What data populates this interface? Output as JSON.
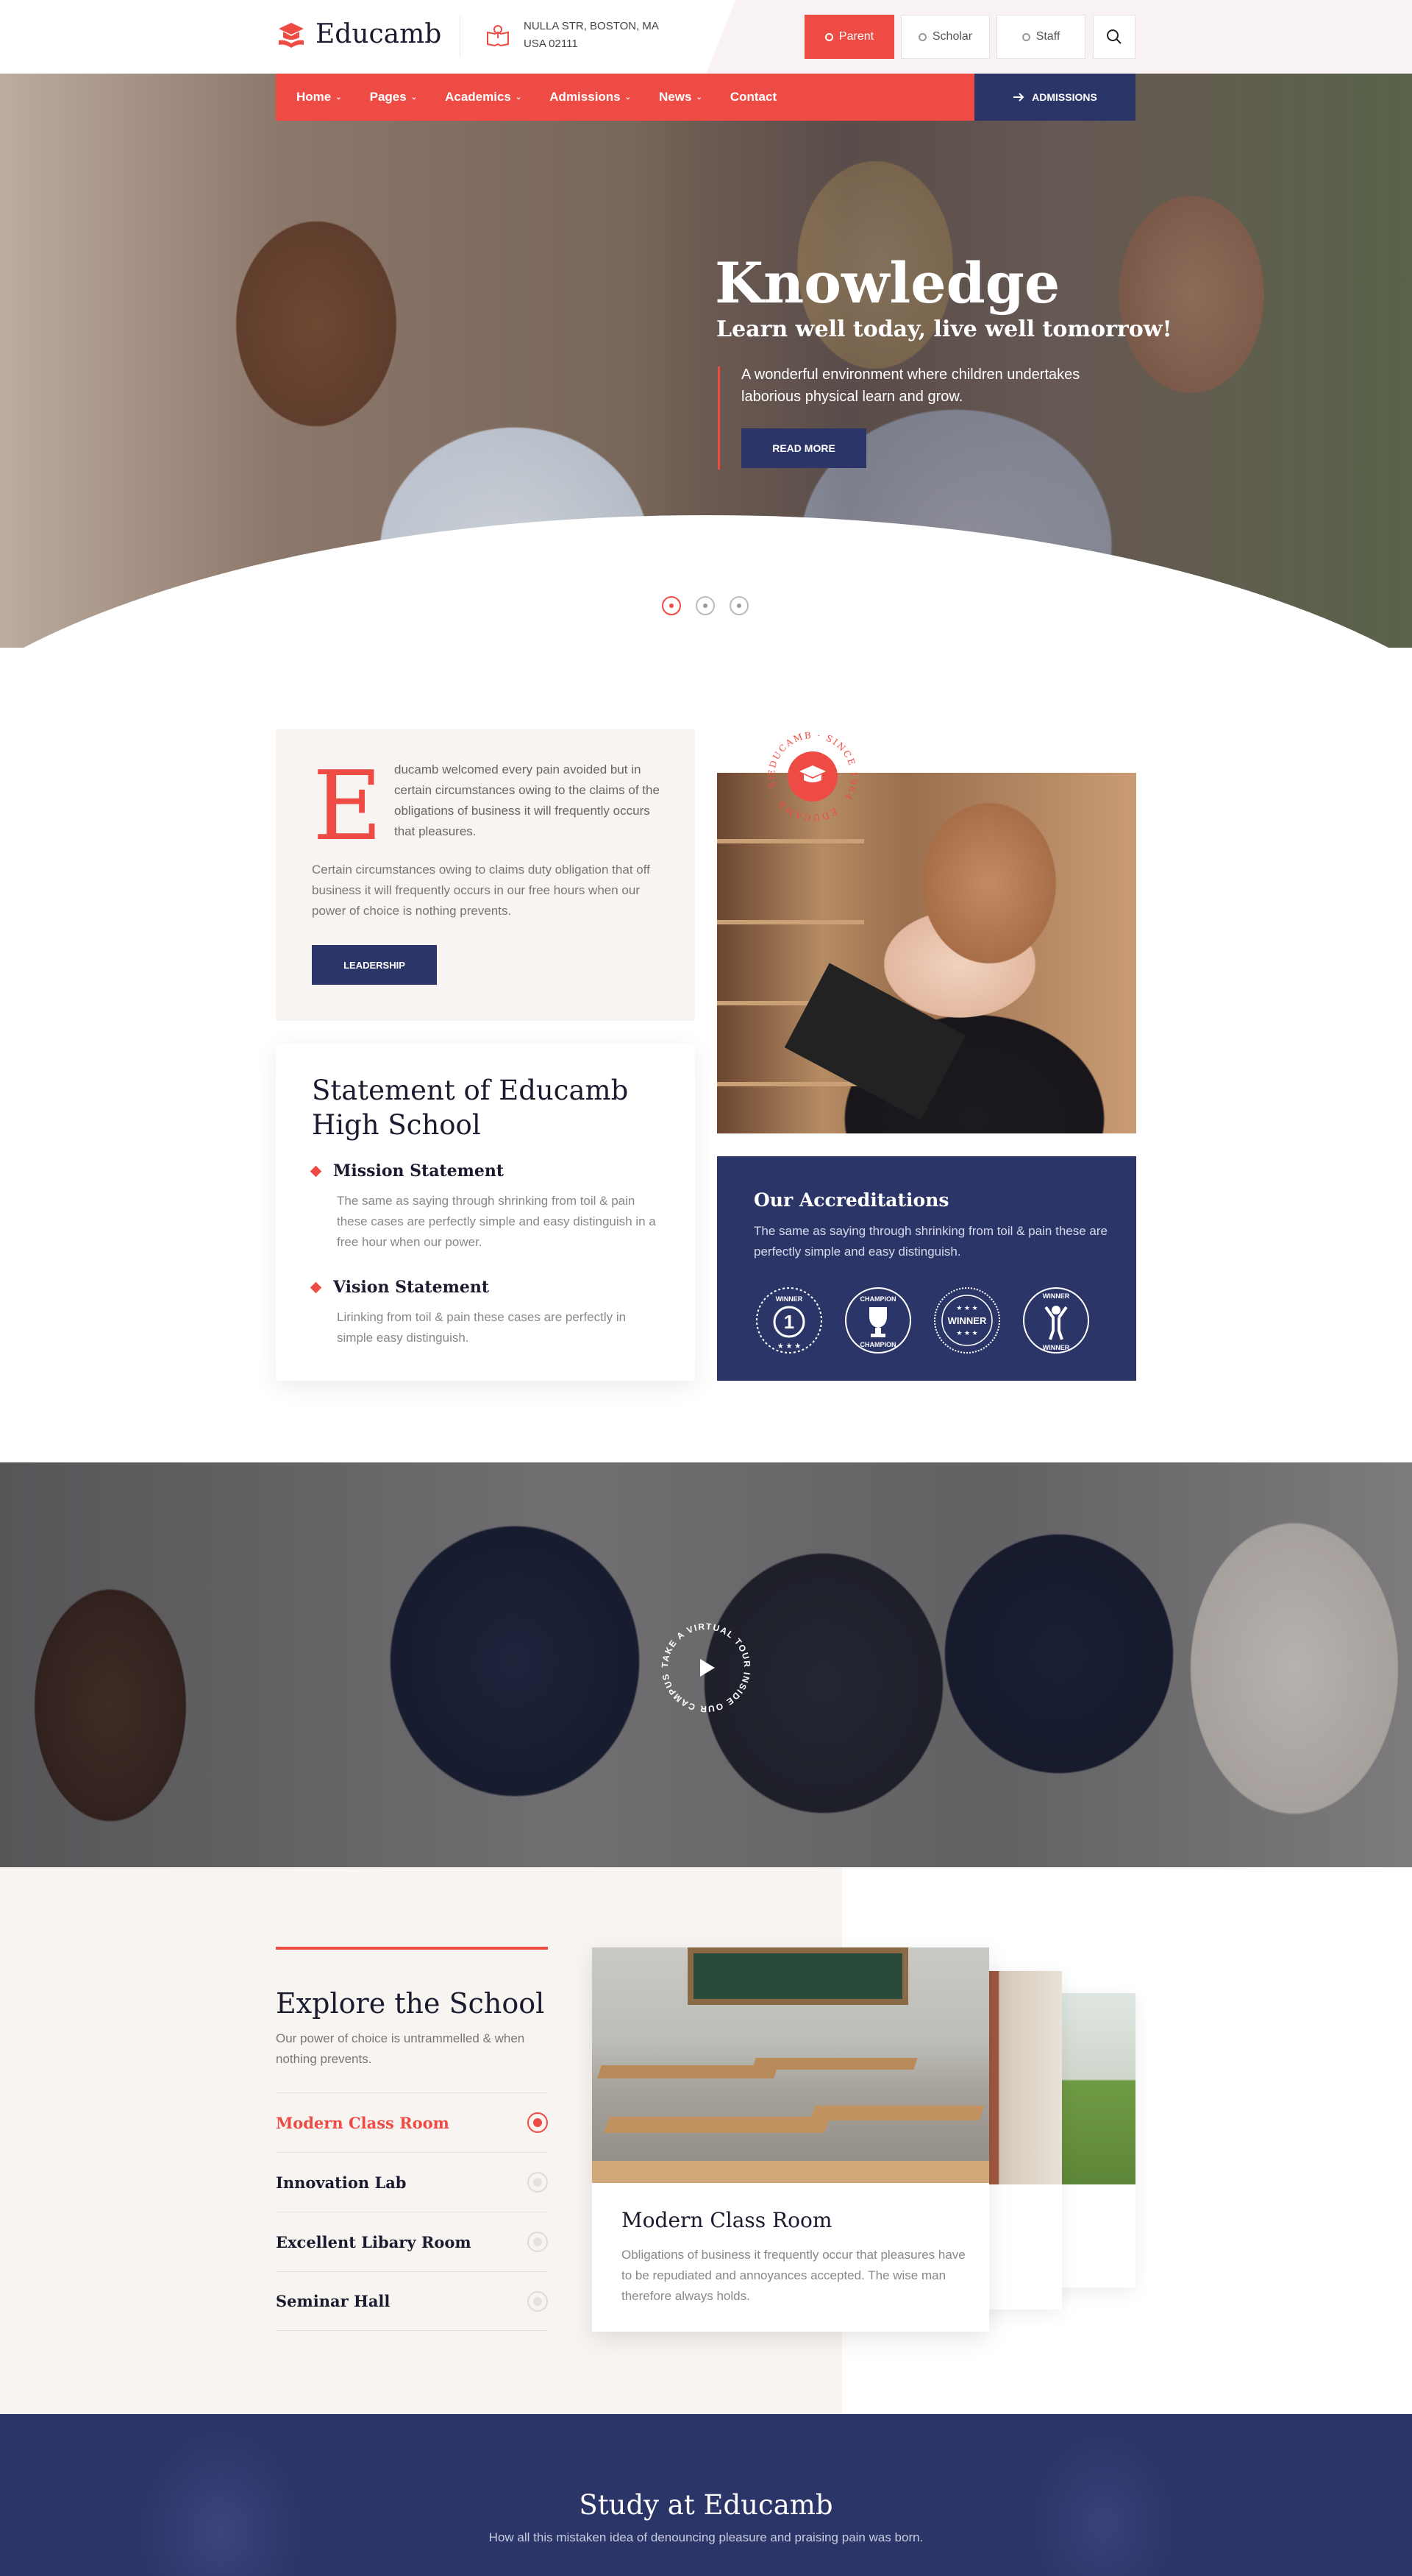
{
  "header": {
    "logo_text": "Educamb",
    "address_line1": "NULLA STR, BOSTON, MA",
    "address_line2": "USA 02111",
    "roles": [
      {
        "label": "Parent",
        "active": true
      },
      {
        "label": "Scholar",
        "active": false
      },
      {
        "label": "Staff",
        "active": false
      }
    ]
  },
  "nav": {
    "items": [
      {
        "label": "Home",
        "dropdown": true
      },
      {
        "label": "Pages",
        "dropdown": true
      },
      {
        "label": "Academics",
        "dropdown": true
      },
      {
        "label": "Admissions",
        "dropdown": true
      },
      {
        "label": "News",
        "dropdown": true
      },
      {
        "label": "Contact",
        "dropdown": false
      }
    ],
    "cta_label": "ADMISSIONS"
  },
  "hero": {
    "title": "Knowledge",
    "subtitle": "Learn well today, live well tomorrow!",
    "description": "A wonderful environment where children undertakes laborious physical learn and grow.",
    "button_label": "READ MORE",
    "slide_count": 3,
    "active_slide": 1
  },
  "about": {
    "dropcap": "E",
    "paragraph1": "ducamb welcomed every pain avoided but in certain circumstances owing to the claims of the obligations of business it will frequently occurs that pleasures.",
    "paragraph2": "Certain circumstances owing to claims duty obligation that off business it will frequently occurs in our free hours when our power of choice is nothing prevents.",
    "button_label": "LEADERSHIP",
    "badge_text": "EDUCAMB · SINCE 1964 · EDUCAMB · SINCE 1964 ·"
  },
  "statement": {
    "title": "Statement of Educamb High School",
    "mission_title": "Mission Statement",
    "mission_text": "The same as saying through shrinking from toil & pain these cases are perfectly simple and easy distinguish in a free hour when our power.",
    "vision_title": "Vision Statement",
    "vision_text": "Lirinking from toil & pain these cases are perfectly in simple easy distinguish."
  },
  "accreditations": {
    "title": "Our Accreditations",
    "text": "The same as saying through shrinking from toil & pain these are perfectly simple and easy distinguish.",
    "awards": [
      {
        "top": "WINNER",
        "center": "1",
        "bottom": ""
      },
      {
        "top": "CHAMPION",
        "center": "",
        "bottom": "CHAMPION"
      },
      {
        "top": "★ ★ ★",
        "center": "WINNER",
        "bottom": "★ ★ ★"
      },
      {
        "top": "WINNER",
        "center": "",
        "bottom": "WINNER"
      }
    ]
  },
  "video": {
    "ring_text": "TAKE A VIRTUAL TOUR INSIDE OUR CAMPUS ·"
  },
  "explore": {
    "title": "Explore the School",
    "subtitle": "Our power of choice is untrammelled & when nothing prevents.",
    "tabs": [
      {
        "label": "Modern Class Room",
        "active": true
      },
      {
        "label": "Innovation Lab",
        "active": false
      },
      {
        "label": "Excellent Libary Room",
        "active": false
      },
      {
        "label": "Seminar Hall",
        "active": false
      }
    ],
    "card_title": "Modern Class Room",
    "card_text": "Obligations of business it frequently occur that pleasures have to be repudiated and annoyances accepted. The wise man therefore always holds."
  },
  "study": {
    "title": "Study at Educamb",
    "subtitle": "How all this mistaken idea of denouncing pleasure and praising pain was born."
  },
  "colors": {
    "accent": "#ee4b44",
    "navy": "#2c3568",
    "cream": "#f8f4f1"
  }
}
